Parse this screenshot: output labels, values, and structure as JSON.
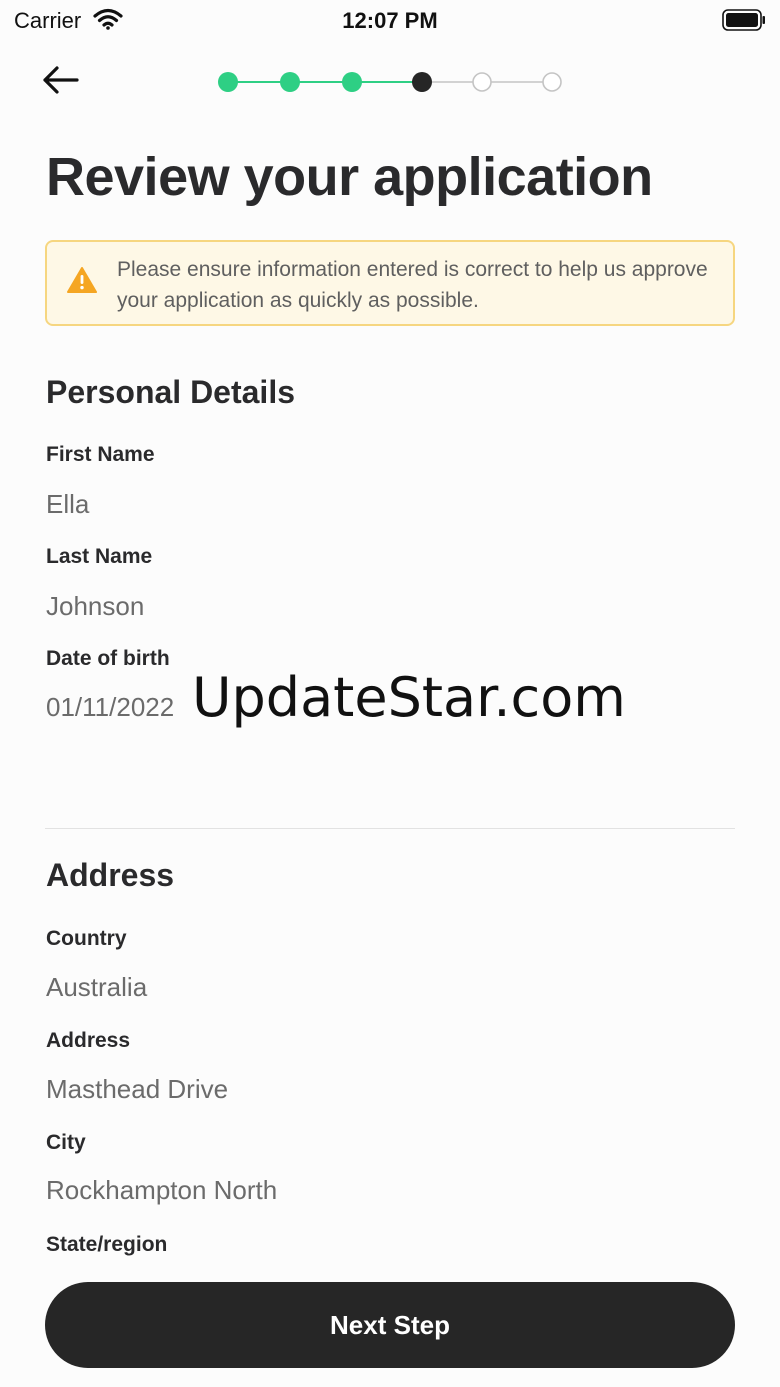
{
  "status_bar": {
    "carrier": "Carrier",
    "time": "12:07 PM",
    "wifi_icon": "wifi-icon",
    "battery_icon": "battery-icon"
  },
  "header": {
    "back_icon": "arrow-left-icon",
    "progress": {
      "total_steps": 6,
      "completed_steps": 3,
      "current_step": 4
    }
  },
  "colors": {
    "step_complete": "#2ecf84",
    "step_current": "#262626",
    "step_pending": "#c4c4c4",
    "notice_bg": "#fef8e6",
    "notice_border": "#f6d680",
    "warning": "#f5a623",
    "primary_button": "#262626"
  },
  "title": "Review your application",
  "notice": {
    "icon": "warning-icon",
    "text": "Please ensure information entered is correct to help us approve your application as quickly as possible."
  },
  "personal_details": {
    "title": "Personal Details",
    "fields": [
      {
        "label": "First Name",
        "value": "Ella"
      },
      {
        "label": "Last Name",
        "value": "Johnson"
      },
      {
        "label": "Date of birth",
        "value": "01/11/2022"
      }
    ]
  },
  "watermark": "UpdateStar.com",
  "address": {
    "title": "Address",
    "fields": [
      {
        "label": "Country",
        "value": "Australia"
      },
      {
        "label": "Address",
        "value": "Masthead Drive"
      },
      {
        "label": "City",
        "value": "Rockhampton North"
      },
      {
        "label": "State/region",
        "value": ""
      }
    ]
  },
  "next_button": {
    "label": "Next Step"
  }
}
